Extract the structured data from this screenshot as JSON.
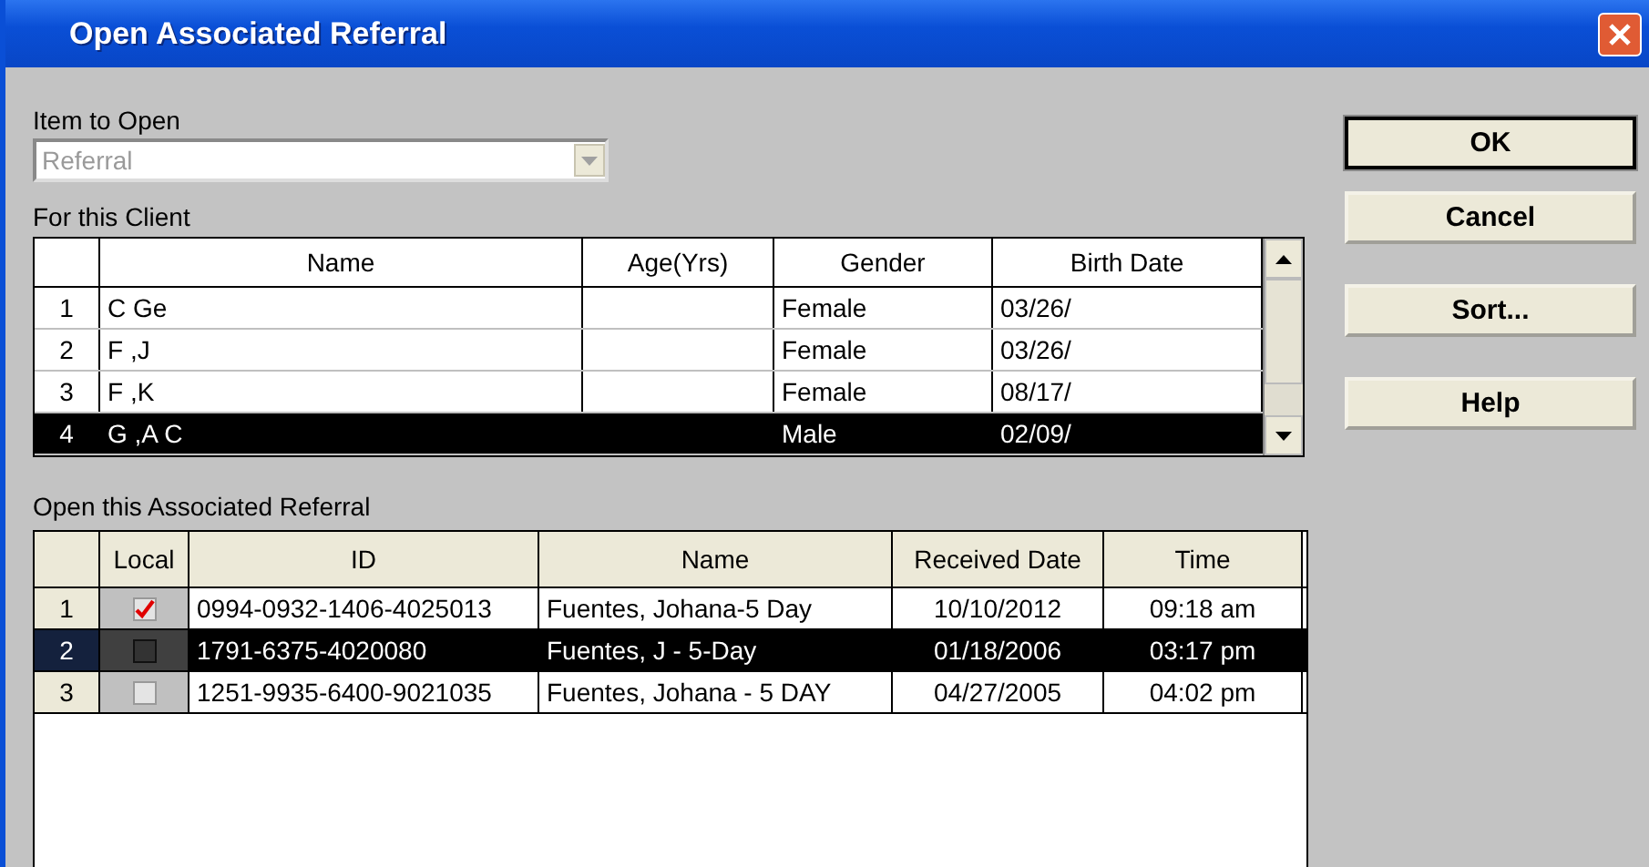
{
  "window": {
    "title": "Open Associated Referral"
  },
  "item_to_open": {
    "label": "Item to Open",
    "value": "Referral",
    "disabled": true
  },
  "client_table": {
    "label": "For this Client",
    "columns": [
      "Name",
      "Age(Yrs)",
      "Gender",
      "Birth Date"
    ],
    "rows": [
      {
        "number": "1",
        "cells": [
          "C Ge",
          "",
          "Female",
          "03/26/"
        ],
        "selected": false
      },
      {
        "number": "2",
        "cells": [
          "F ,J",
          "",
          "Female",
          "03/26/"
        ],
        "selected": false
      },
      {
        "number": "3",
        "cells": [
          "F ,K",
          "",
          "Female",
          "08/17/"
        ],
        "selected": false
      },
      {
        "number": "4",
        "cells": [
          "G ,A C",
          "",
          "Male",
          "02/09/"
        ],
        "selected": true
      }
    ]
  },
  "referral_table": {
    "label": "Open this Associated Referral",
    "checkbox_column": "Local",
    "columns": [
      "ID",
      "Name",
      "Received Date",
      "Time"
    ],
    "rows": [
      {
        "number": "1",
        "local": true,
        "cells": [
          "0994-0932-1406-4025013",
          "Fuentes, Johana-5 Day",
          "10/10/2012",
          "09:18 am"
        ],
        "selected": false
      },
      {
        "number": "2",
        "local": false,
        "cells": [
          "1791-6375-4020080",
          "Fuentes, J - 5-Day",
          "01/18/2006",
          "03:17 pm"
        ],
        "selected": true
      },
      {
        "number": "3",
        "local": false,
        "cells": [
          "1251-9935-6400-9021035",
          "Fuentes, Johana - 5 DAY",
          "04/27/2005",
          "04:02 pm"
        ],
        "selected": false
      }
    ]
  },
  "buttons": [
    {
      "label": "OK",
      "default": true
    },
    {
      "label": "Cancel",
      "default": false
    },
    {
      "label": "Sort...",
      "default": false
    },
    {
      "label": "Help",
      "default": false
    }
  ]
}
